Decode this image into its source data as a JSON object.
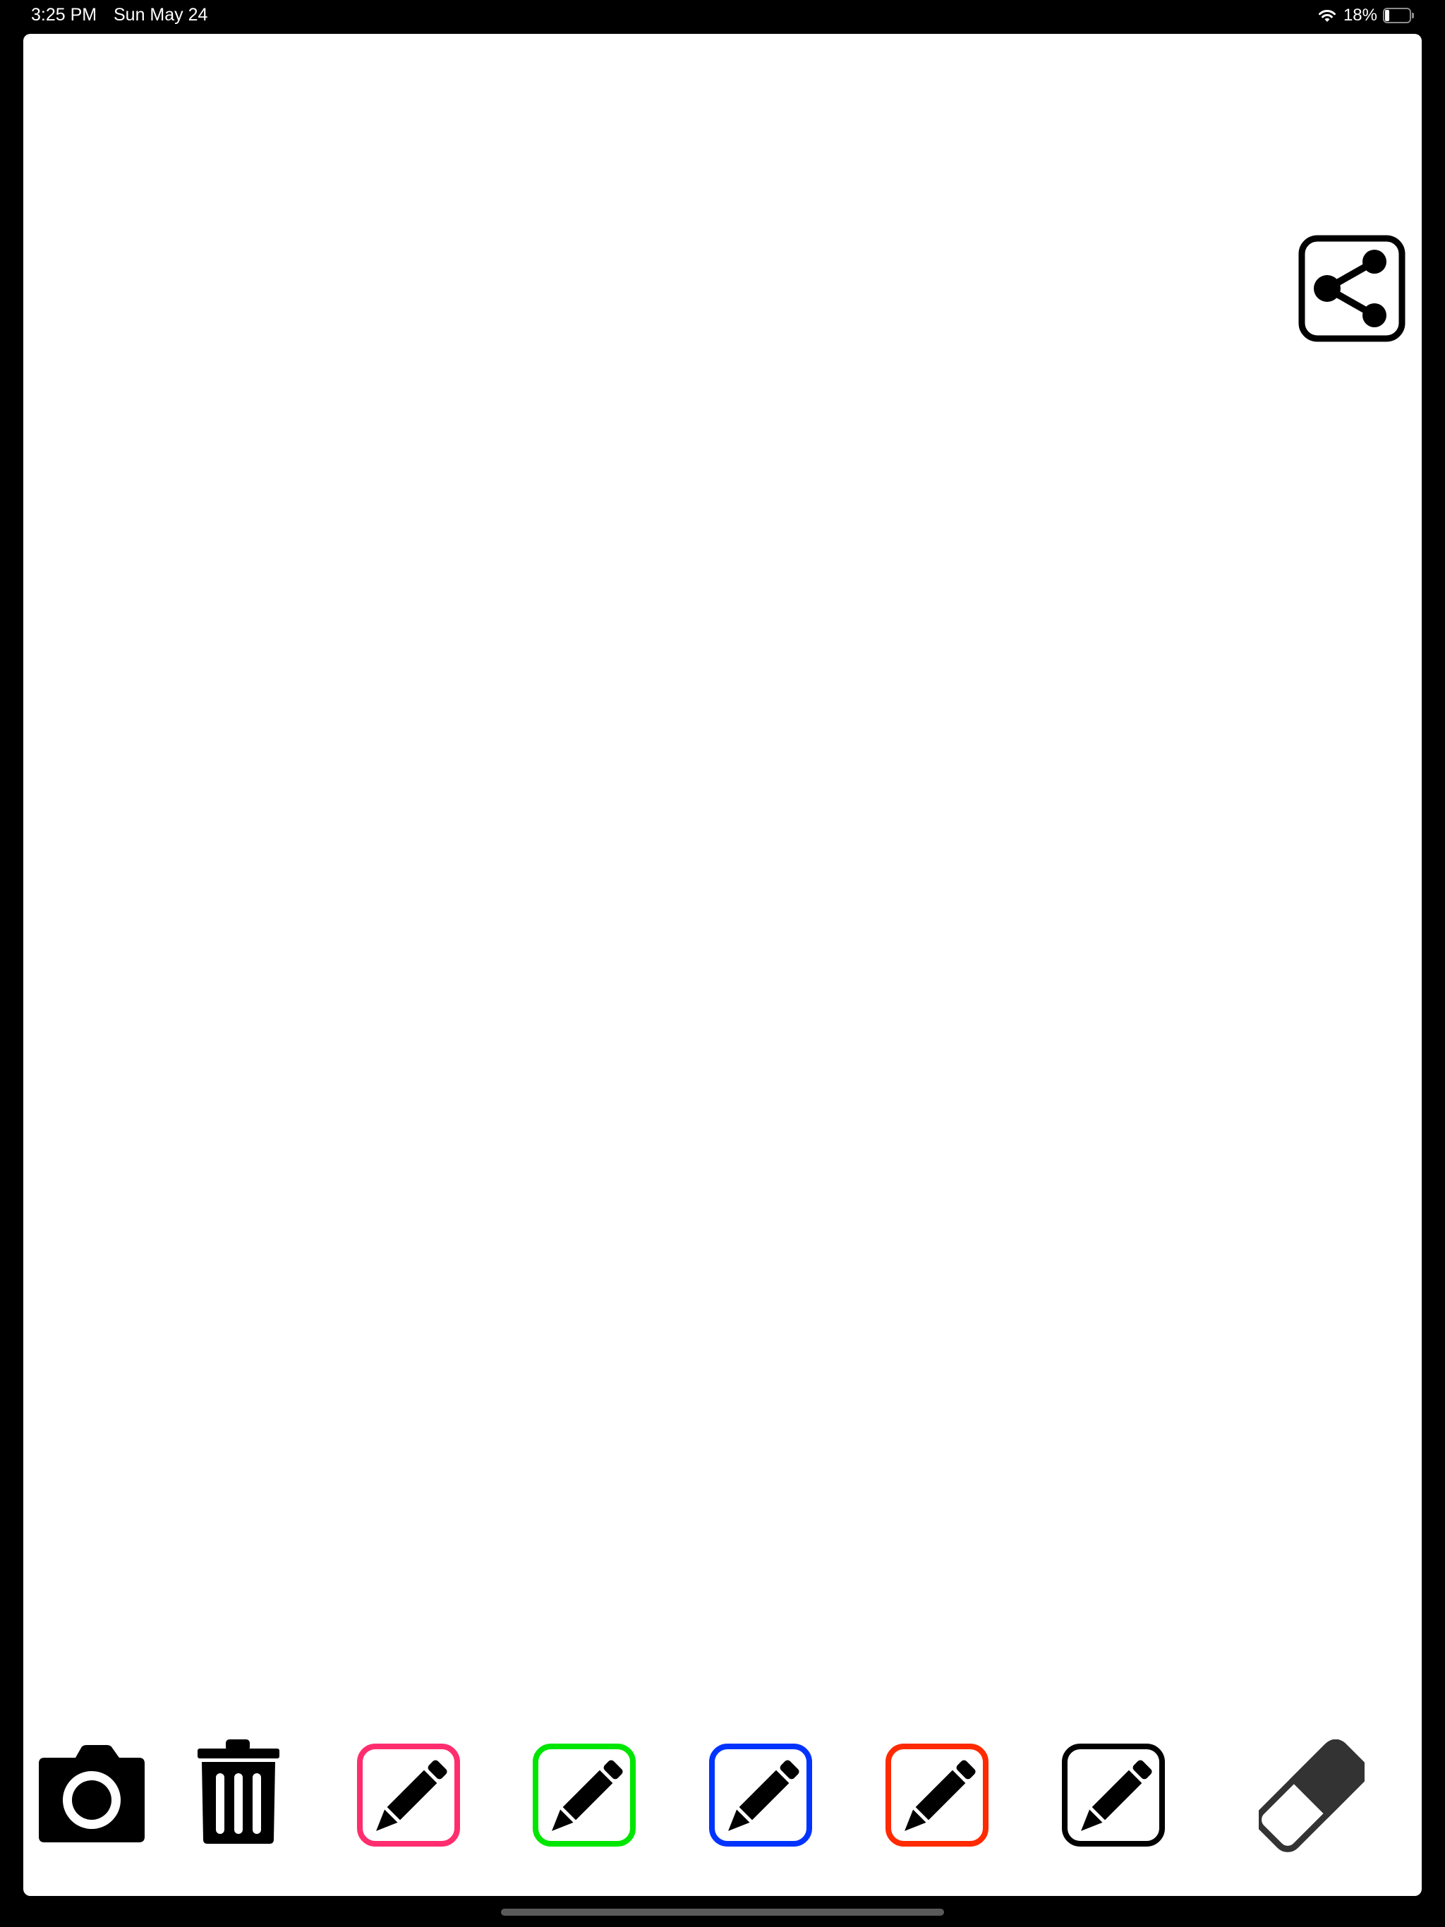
{
  "status_bar": {
    "time": "3:25 PM",
    "date": "Sun May 24",
    "battery_percent_label": "18%",
    "battery_level": 0.18,
    "icons": [
      "wifi-icon",
      "battery-icon"
    ]
  },
  "canvas": {
    "share_icon": "share-icon"
  },
  "toolbar": {
    "tools": [
      {
        "name": "camera",
        "icon": "camera-icon"
      },
      {
        "name": "trash",
        "icon": "trash-icon"
      },
      {
        "name": "pen-pink",
        "icon": "pencil-icon",
        "color": "#FF2D6E"
      },
      {
        "name": "pen-green",
        "icon": "pencil-icon",
        "color": "#00E600"
      },
      {
        "name": "pen-blue",
        "icon": "pencil-icon",
        "color": "#0033FF"
      },
      {
        "name": "pen-red",
        "icon": "pencil-icon",
        "color": "#FF2A00"
      },
      {
        "name": "pen-black",
        "icon": "pencil-icon",
        "color": "#000000"
      },
      {
        "name": "eraser",
        "icon": "eraser-icon",
        "color": "#333333"
      }
    ]
  }
}
